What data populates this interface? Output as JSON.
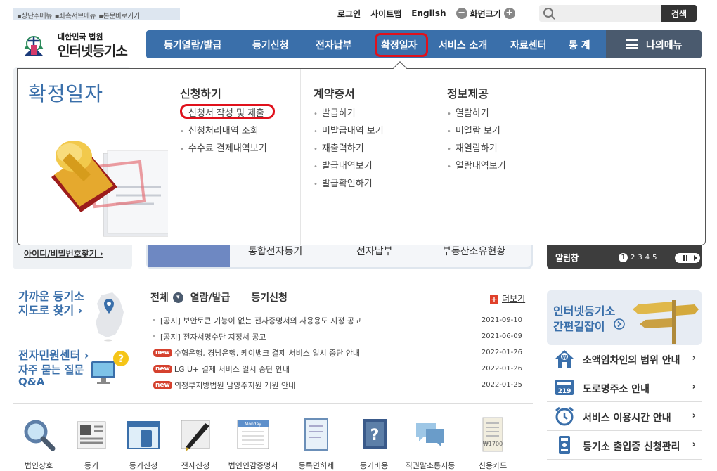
{
  "skip_links": [
    "▪상단주메뉴",
    "▪좌측서브메뉴",
    "▪본문바로가기"
  ],
  "util": {
    "login": "로그인",
    "sitemap": "사이트맵",
    "english": "English",
    "zoom_label": "화면크기",
    "minus": "−",
    "plus": "+"
  },
  "search": {
    "placeholder": "",
    "button": "검색"
  },
  "logo": {
    "emblem_text": "대한민국법원",
    "sub": "대한민국 법원",
    "title": "인터넷등기소"
  },
  "gnb": [
    "등기열람/발급",
    "등기신청",
    "전자납부",
    "확정일자",
    "서비스 소개",
    "자료센터",
    "통 계"
  ],
  "mymenu": "나의메뉴",
  "dropdown": {
    "big_title": "확정일자",
    "columns": [
      {
        "title": "신청하기",
        "items": [
          "신청서 작성 및 제출",
          "신청처리내역 조회",
          "수수료 결제내역보기"
        ]
      },
      {
        "title": "계약증서",
        "items": [
          "발급하기",
          "미발급내역 보기",
          "재출력하기",
          "발급내역보기",
          "발급확인하기"
        ]
      },
      {
        "title": "정보제공",
        "items": [
          "열람하기",
          "미열람 보기",
          "재열람하기",
          "열람내역보기"
        ]
      }
    ]
  },
  "background": {
    "id_link": "아이디/비밀번호찾기 ›",
    "mid_items": [
      "통합전자등기",
      "전자납부",
      "부동산소유현황"
    ],
    "alert": "알림창",
    "pages": [
      "1",
      "2",
      "3",
      "4",
      "5"
    ]
  },
  "side": {
    "near_1": "가까운 등기소",
    "near_2": "지도로 찾기 ›",
    "minwon": "전자민원센터 ›",
    "faq_1": "자주 묻는 질문",
    "faq_2": "Q&A"
  },
  "news": {
    "tabs": [
      "전체",
      "열람/발급",
      "등기신청"
    ],
    "tab_dropdown": "▾",
    "more_icon": "+",
    "more": "더보기",
    "new_badge": "new",
    "items": [
      {
        "new": false,
        "title": "[공지] 보안토큰 기능이 없는 전자증명서의 사용용도 지정 공고",
        "date": "2021-09-10"
      },
      {
        "new": false,
        "title": "[공지] 전자서명수단 지정서 공고",
        "date": "2021-06-09"
      },
      {
        "new": true,
        "title": "수협은행, 경남은행, 케이뱅크 결제 서비스 일시 중단 안내",
        "date": "2022-01-26"
      },
      {
        "new": true,
        "title": "LG U+ 결제 서비스 일시 중단 안내",
        "date": "2022-01-26"
      },
      {
        "new": true,
        "title": "의정부지방법원 남양주지원 개원 안내",
        "date": "2022-01-25"
      }
    ]
  },
  "quick": [
    {
      "label": "법인상호",
      "icon": "magnifier-icon"
    },
    {
      "label": "등기",
      "icon": "newspaper-icon"
    },
    {
      "label": "등기신청",
      "icon": "browser-icon"
    },
    {
      "label": "전자신청",
      "icon": "pen-icon"
    },
    {
      "label": "법인인감증명서",
      "icon": "calendar-icon"
    },
    {
      "label": "등록면허세",
      "icon": "document-icon"
    },
    {
      "label": "등기비용",
      "icon": "question-book-icon"
    },
    {
      "label": "직권말소통지등",
      "icon": "chat-icon"
    },
    {
      "label": "신용카드",
      "icon": "receipt-icon"
    }
  ],
  "receipt_amount": "₩1700",
  "calendar_day": "Monday",
  "easy": {
    "line1": "인터넷등기소",
    "line2": "간편길잡이"
  },
  "right_links": [
    {
      "label": "소액임차인의 범위 안내",
      "icon": "house-icon"
    },
    {
      "label": "도로명주소 안내",
      "icon": "road-sign-icon",
      "code": "219"
    },
    {
      "label": "서비스 이용시간 안내",
      "icon": "alarm-clock-icon"
    },
    {
      "label": "등기소 출입증 신청관리",
      "icon": "id-card-icon"
    }
  ],
  "colors": {
    "primary": "#3a6faa",
    "highlight": "#e0111c",
    "mymenu": "#4a5a6e"
  }
}
